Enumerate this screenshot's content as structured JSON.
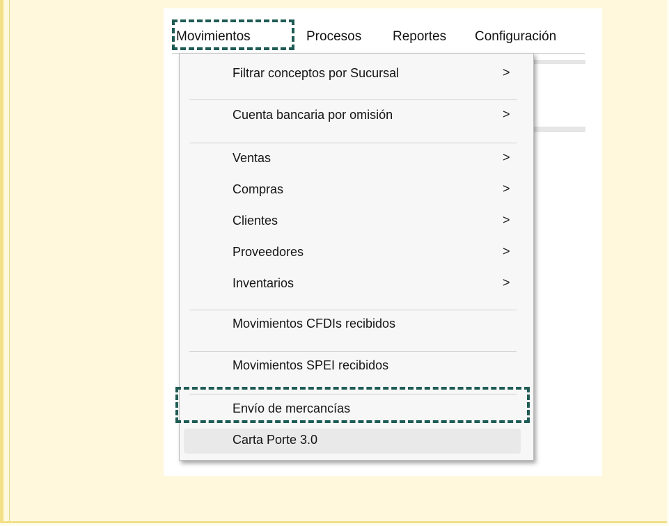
{
  "menubar": {
    "items": [
      {
        "label": "Movimientos"
      },
      {
        "label": "Procesos"
      },
      {
        "label": "Reportes"
      },
      {
        "label": "Configuración"
      }
    ]
  },
  "menu": {
    "groups": [
      [
        {
          "label": "Filtrar conceptos por Sucursal",
          "submenu": true
        }
      ],
      [
        {
          "label": "Cuenta bancaria por omisión",
          "submenu": true
        }
      ],
      [
        {
          "label": "Ventas",
          "submenu": true
        },
        {
          "label": "Compras",
          "submenu": true
        },
        {
          "label": "Clientes",
          "submenu": true
        },
        {
          "label": "Proveedores",
          "submenu": true
        },
        {
          "label": "Inventarios",
          "submenu": true
        }
      ],
      [
        {
          "label": "Movimientos CFDIs recibidos",
          "submenu": false
        }
      ],
      [
        {
          "label": "Movimientos SPEI recibidos",
          "submenu": false
        }
      ],
      [
        {
          "label": "Envío de mercancías",
          "submenu": false,
          "highlighted_box": true
        },
        {
          "label": "Carta Porte 3.0",
          "submenu": false,
          "hovered": true
        }
      ]
    ],
    "arrow_glyph": ">"
  },
  "colors": {
    "frame_background": "#fff8dc",
    "frame_border": "#f2df88",
    "dashed_highlight": "#1f5c55",
    "menu_background": "#f7f7f7",
    "hover_background": "#e9e9e9"
  }
}
